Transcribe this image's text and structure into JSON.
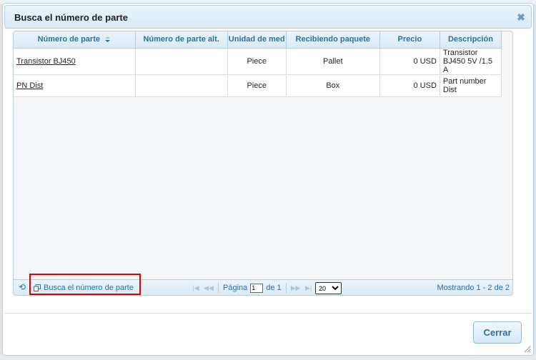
{
  "dialog": {
    "title": "Busca el número de parte",
    "close_icon": "close-icon",
    "close_label": "Cerrar"
  },
  "grid": {
    "columns": [
      "Número de parte",
      "Número de parte alt.",
      "Unidad de med",
      "Recibiendo paquete",
      "Precio",
      "Descripción"
    ],
    "rows": [
      {
        "part_number": "Transistor BJ450",
        "alt_part_number": "",
        "unit": "Piece",
        "receiving_package": "Pallet",
        "price": "0 USD",
        "description": "Transistor BJ450 5V /1.5 A"
      },
      {
        "part_number": "PN Dist",
        "alt_part_number": "",
        "unit": "Piece",
        "receiving_package": "Box",
        "price": "0 USD",
        "description": "Part number Dist"
      }
    ]
  },
  "pager": {
    "search_label": "Busca el número de parte",
    "page_label": "Página",
    "page_value": "1",
    "of_label": "de 1",
    "rows_per_page": "20",
    "rows_options": [
      "20"
    ],
    "count_text": "Mostrando 1 - 2 de 2"
  },
  "colors": {
    "accent": "#2e6e9e",
    "border": "#aed0ea",
    "highlight": "#e00000"
  }
}
